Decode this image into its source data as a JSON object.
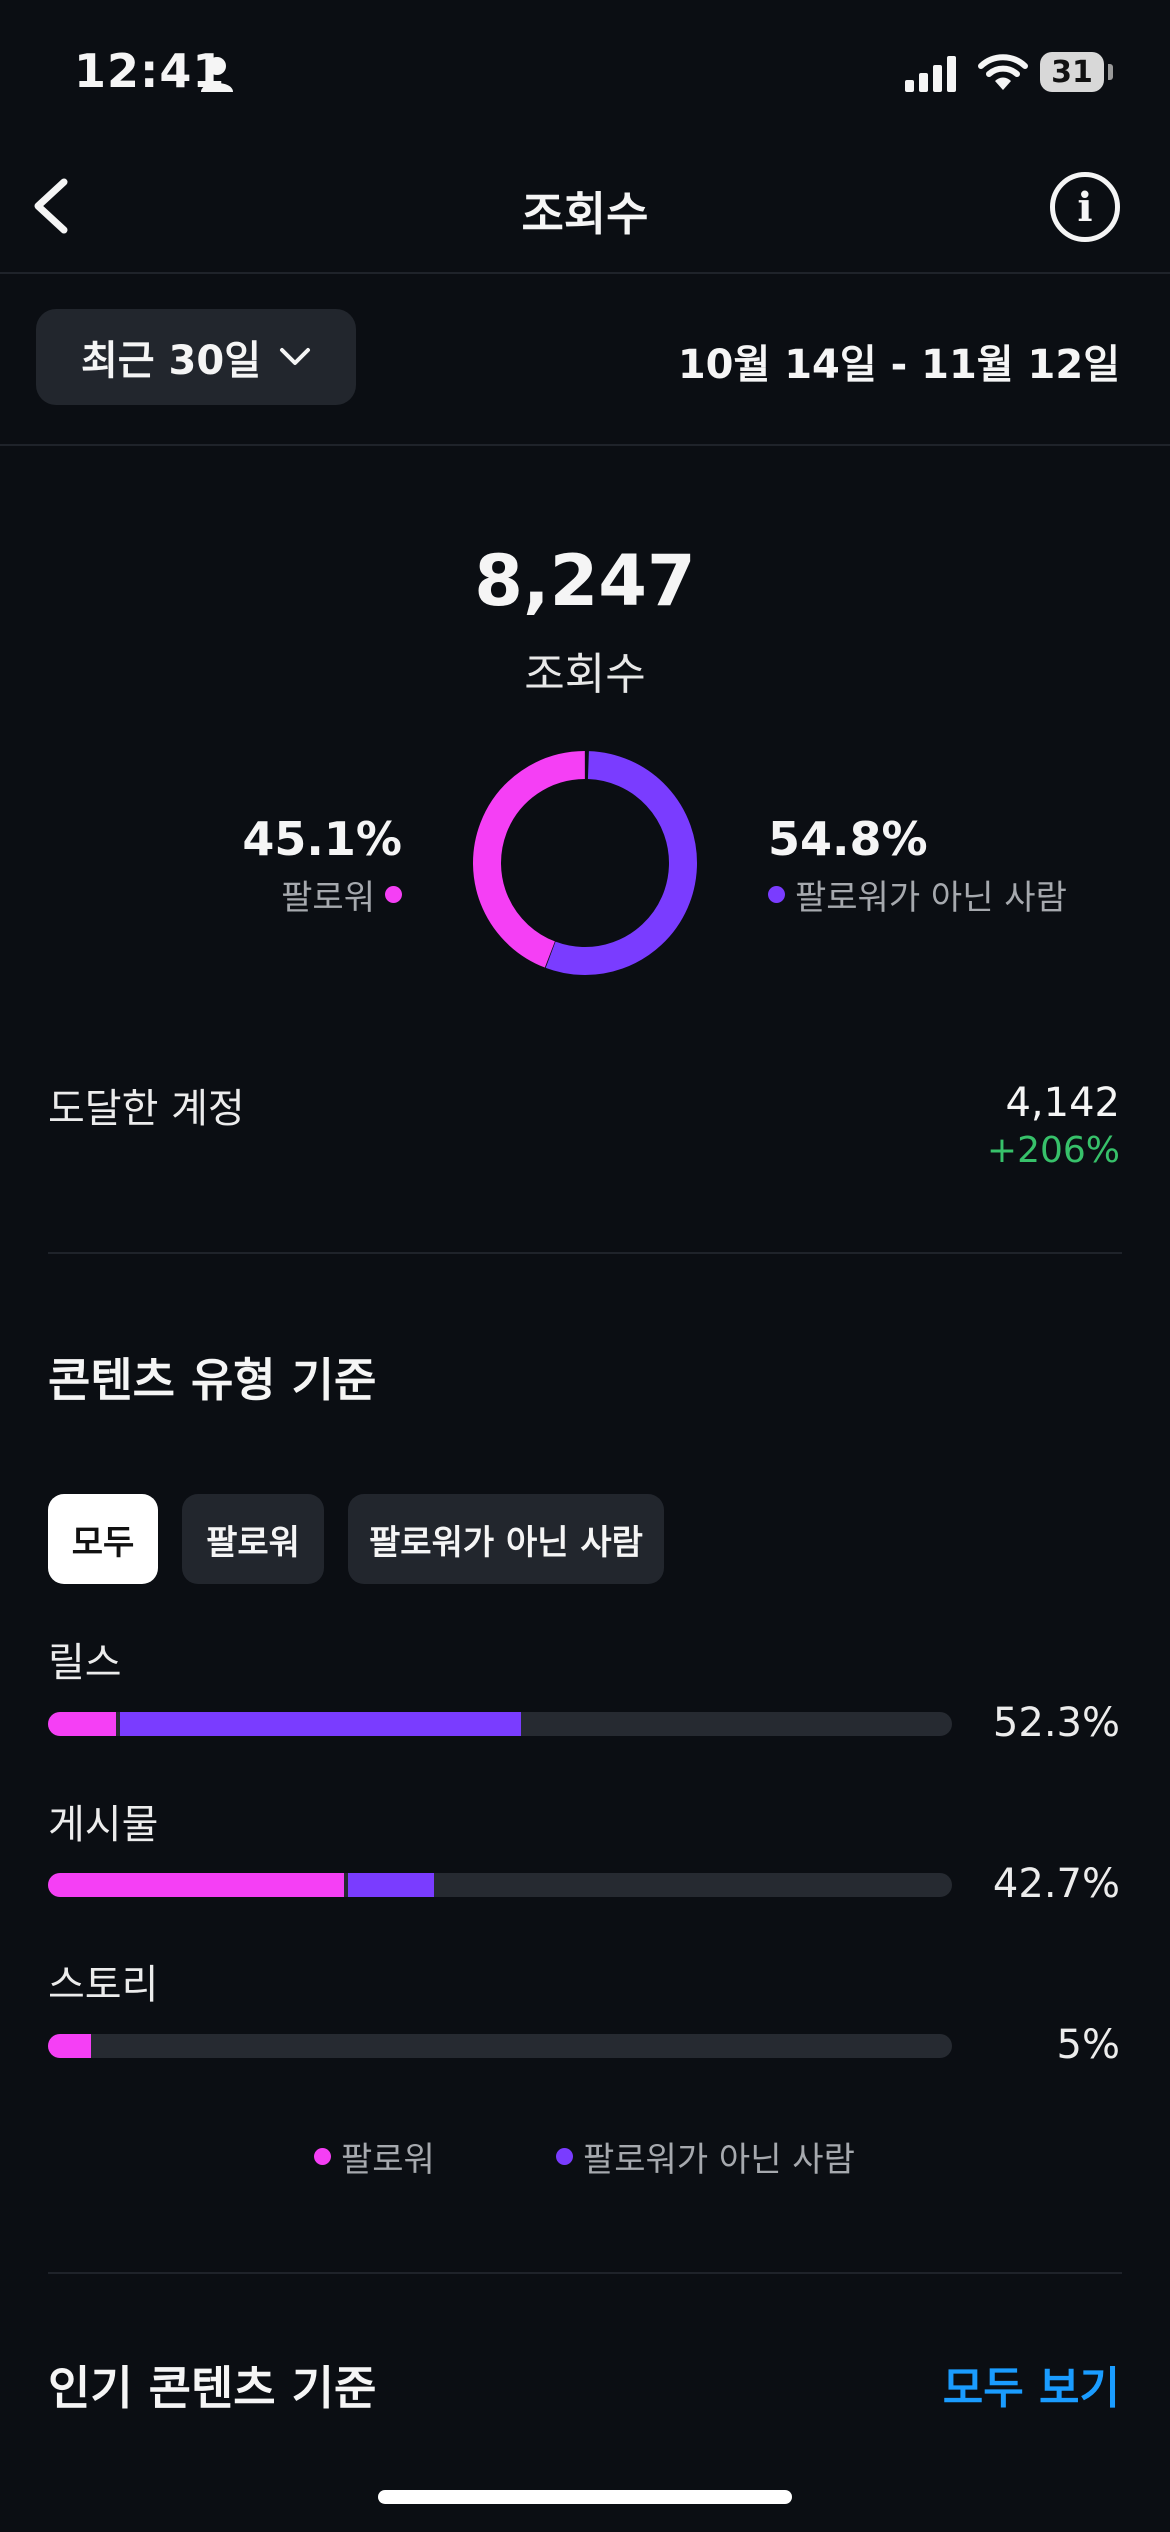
{
  "status_bar": {
    "time": "12:41",
    "battery": "31"
  },
  "header": {
    "title": "조회수"
  },
  "period": {
    "selected": "최근 30일",
    "date_range": "10월 14일 - 11월 12일"
  },
  "total": {
    "value": "8,247",
    "label": "조회수"
  },
  "split": {
    "followers": {
      "pct": "45.1%",
      "label": "팔로워",
      "fraction": 0.451,
      "color": "#f53ff5"
    },
    "non_followers": {
      "pct": "54.8%",
      "label": "팔로워가 아닌 사람",
      "fraction": 0.548,
      "color": "#7a3cff"
    }
  },
  "reached": {
    "label": "도달한 계정",
    "value": "4,142",
    "change": "+206%"
  },
  "content_type": {
    "title": "콘텐츠 유형 기준",
    "filters": [
      "모두",
      "팔로워",
      "팔로워가 아닌 사람"
    ],
    "active_filter": "모두",
    "rows": [
      {
        "label": "릴스",
        "pct": "52.3%",
        "followers": 0.075,
        "non_followers": 0.448
      },
      {
        "label": "게시물",
        "pct": "42.7%",
        "followers": 0.327,
        "non_followers": 0.1
      },
      {
        "label": "스토리",
        "pct": "5%",
        "followers": 0.048,
        "non_followers": 0.004
      }
    ],
    "legend": {
      "followers": "팔로워",
      "non_followers": "팔로워가 아닌 사람"
    }
  },
  "top_content": {
    "title": "인기 콘텐츠 기준",
    "see_all": "모두 보기"
  }
}
